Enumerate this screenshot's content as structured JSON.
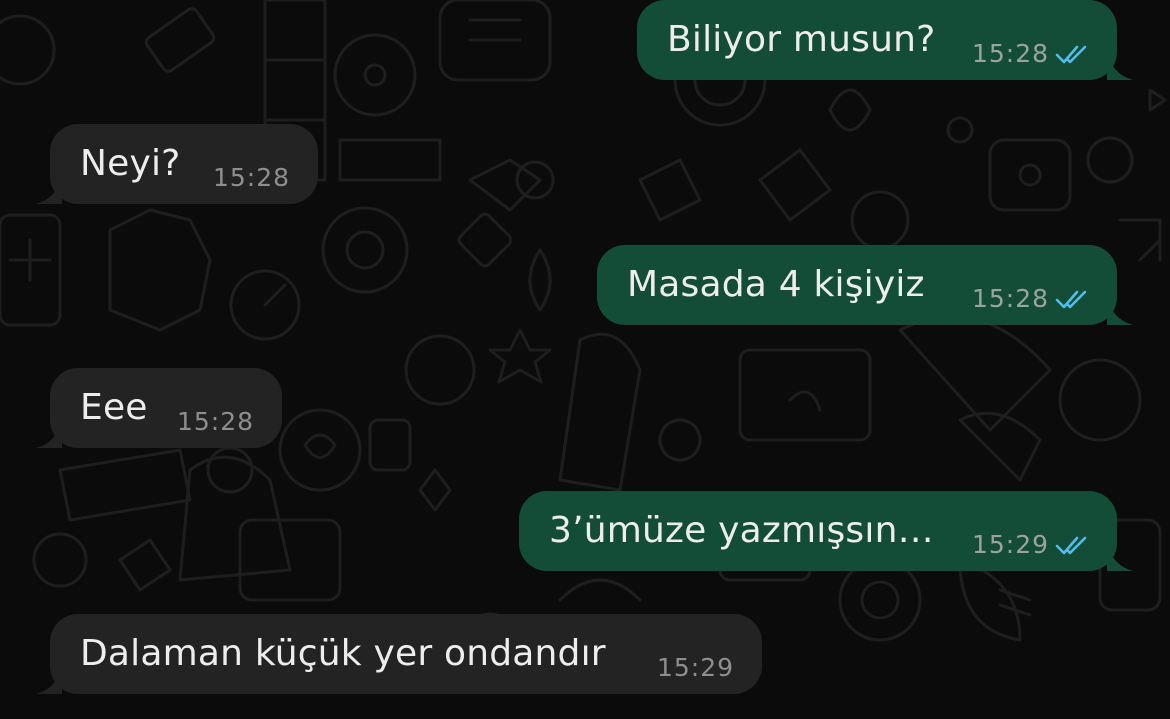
{
  "colors": {
    "background": "#0b0b0b",
    "incoming_bubble": "#232323",
    "outgoing_bubble": "#144d37",
    "message_text": "#ededed",
    "read_ticks": "#53bdeb"
  },
  "messages": [
    {
      "direction": "outgoing",
      "text": "Biliyor musun?",
      "time": "15:28",
      "status": "read"
    },
    {
      "direction": "incoming",
      "text": "Neyi?",
      "time": "15:28"
    },
    {
      "direction": "outgoing",
      "text": "Masada 4 kişiyiz",
      "time": "15:28",
      "status": "read"
    },
    {
      "direction": "incoming",
      "text": "Eee",
      "time": "15:28"
    },
    {
      "direction": "outgoing",
      "text": "3’ümüze yazmışsın…",
      "time": "15:29",
      "status": "read"
    },
    {
      "direction": "incoming",
      "text": "Dalaman küçük yer ondandır",
      "time": "15:29"
    }
  ],
  "icons": {
    "read_receipt": "double-check-icon"
  }
}
